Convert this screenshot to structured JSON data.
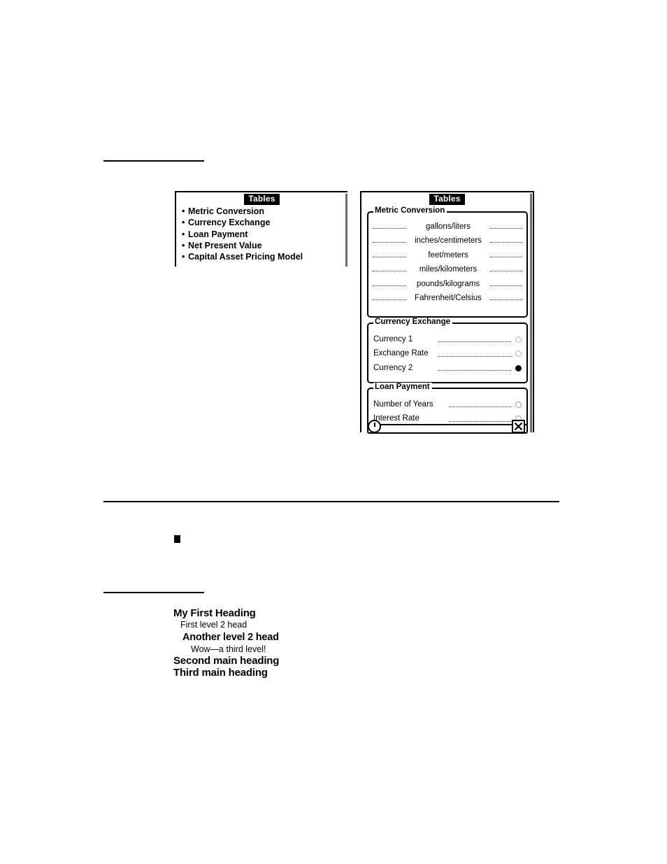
{
  "rules": {
    "top_short": "horizontal-rule",
    "mid_long": "horizontal-rule",
    "bottom_short": "horizontal-rule"
  },
  "bullet_marker": {
    "glyph": "square-bullet"
  },
  "pda_left": {
    "title": "Tables",
    "scrollbar": "vertical-scrollbar",
    "menu_items": [
      {
        "bullet": "•",
        "label": "Metric Conversion"
      },
      {
        "bullet": "•",
        "label": "Currency Exchange"
      },
      {
        "bullet": "•",
        "label": "Loan Payment"
      },
      {
        "bullet": "•",
        "label": "Net Present Value"
      },
      {
        "bullet": "•",
        "label": "Capital Asset Pricing Model"
      }
    ]
  },
  "pda_right": {
    "title": "Tables",
    "scrollbar": "vertical-scrollbar",
    "groups": {
      "metric": {
        "legend": "Metric Conversion",
        "rows": [
          {
            "label": "gallons/liters"
          },
          {
            "label": "inches/centimeters"
          },
          {
            "label": "feet/meters"
          },
          {
            "label": "miles/kilometers"
          },
          {
            "label": "pounds/kilograms"
          },
          {
            "label": "Fahrenheit/Celsius"
          }
        ]
      },
      "currency": {
        "legend": "Currency Exchange",
        "rows": [
          {
            "label": "Currency 1",
            "selected": false
          },
          {
            "label": "Exchange Rate",
            "selected": false
          },
          {
            "label": "Currency 2",
            "selected": true
          }
        ]
      },
      "loan": {
        "legend": "Loan Payment",
        "rows": [
          {
            "label": "Number of Years",
            "selected": false
          },
          {
            "label": "Interest Rate",
            "selected": false
          }
        ]
      }
    },
    "toolbar": {
      "left_icon": "clock-icon",
      "right_icon": "close-icon"
    }
  },
  "heading_sample": {
    "line1": "My First Heading",
    "line2": "First level 2 head",
    "line3": "Another level 2 head",
    "line4": "Wow—a third level!",
    "line5": "Second main heading",
    "line6": "Third main heading"
  },
  "colors": {
    "ink": "#000000",
    "paper": "#ffffff",
    "scrollbar": "#6e6e6e",
    "dot_leader": "#333333"
  }
}
